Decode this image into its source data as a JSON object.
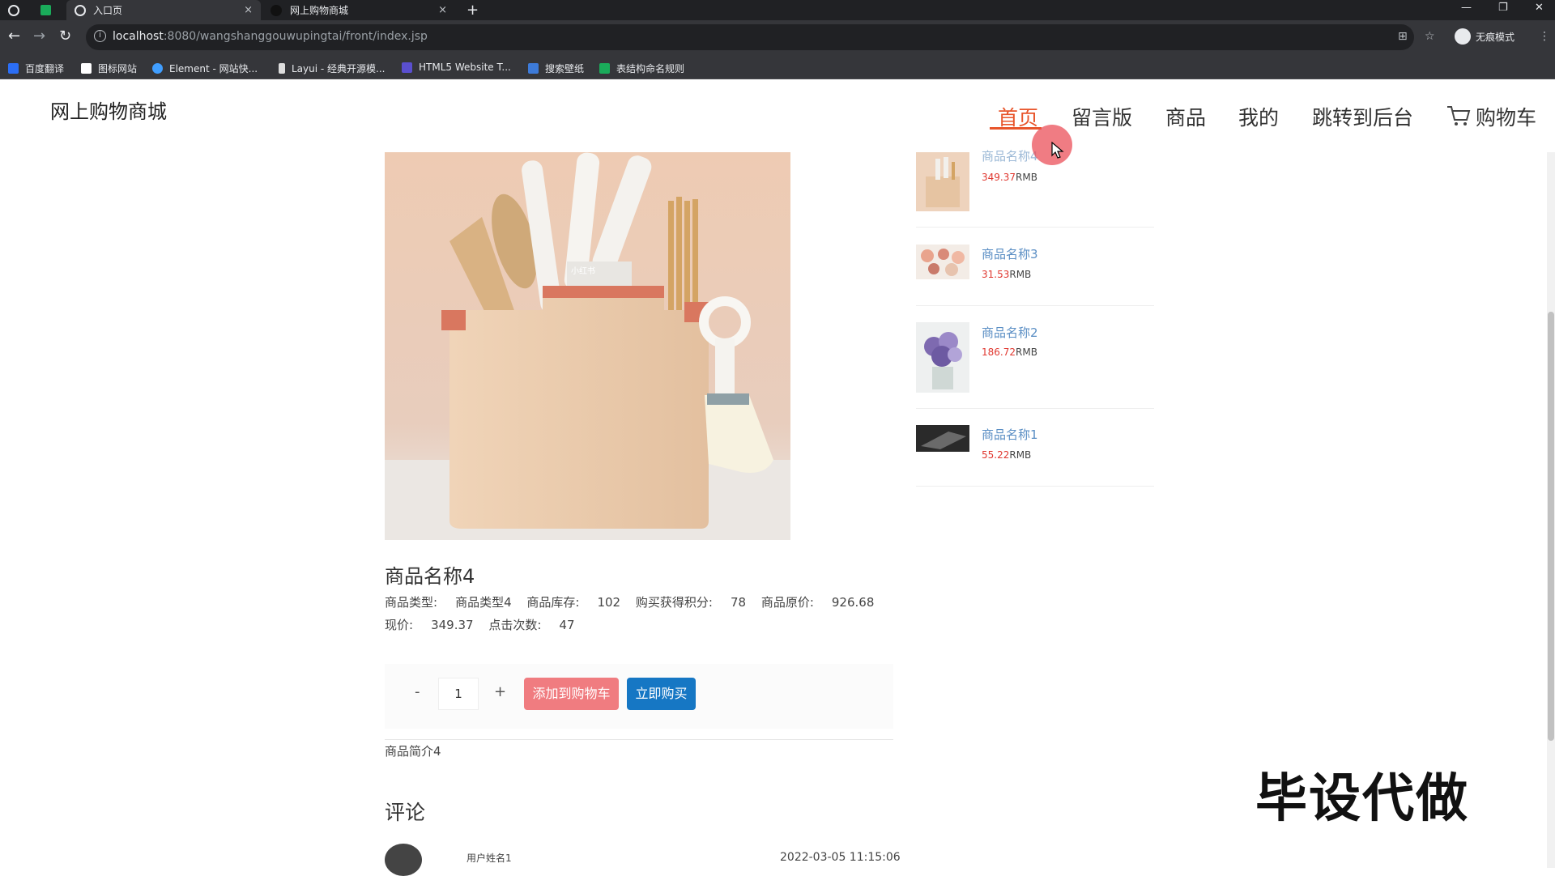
{
  "browser": {
    "tabs": [
      {
        "title": "入口页",
        "close": "×"
      },
      {
        "title": "网上购物商城",
        "close": "×"
      }
    ],
    "new_tab": "+",
    "url_host": "localhost",
    "url_path": ":8080/wangshanggouwupingtai/front/index.jsp",
    "incognito_label": "无痕模式",
    "bookmarks": [
      {
        "label": "百度翻译",
        "color": "#2b6ef5"
      },
      {
        "label": "图标网站",
        "color": "#ffffff"
      },
      {
        "label": "Element - 网站快...",
        "color": "#409eff"
      },
      {
        "label": "Layui - 经典开源模...",
        "color": "#dddddd"
      },
      {
        "label": "HTML5 Website T...",
        "color": "#5a4fcf"
      },
      {
        "label": "搜索壁纸",
        "color": "#3d7bd9"
      },
      {
        "label": "表结构命名规则",
        "color": "#1aab5a"
      }
    ]
  },
  "site": {
    "logo": "网上购物商城",
    "menu": [
      "首页",
      "留言版",
      "商品",
      "我的",
      "跳转到后台",
      "购物车"
    ]
  },
  "product": {
    "name": "商品名称4",
    "type_label": "商品类型:",
    "type_value": "商品类型4",
    "stock_label": "商品库存:",
    "stock_value": "102",
    "points_label": "购买获得积分:",
    "points_value": "78",
    "orig_price_label": "商品原价:",
    "orig_price_value": "926.68",
    "price_label": "现价:",
    "price_value": "349.37",
    "clicks_label": "点击次数:",
    "clicks_value": "47",
    "qty_minus": "-",
    "qty_value": "1",
    "qty_plus": "+",
    "add_cart": "添加到购物车",
    "buy_now": "立即购买",
    "intro": "商品简介4",
    "image_caption": "小红书"
  },
  "comments": {
    "title": "评论",
    "items": [
      {
        "user": "用户姓名1",
        "time": "2022-03-05 11:15:06"
      }
    ]
  },
  "recommend": [
    {
      "name": "商品名称4",
      "price": "349.37",
      "unit": "RMB"
    },
    {
      "name": "商品名称3",
      "price": "31.53",
      "unit": "RMB"
    },
    {
      "name": "商品名称2",
      "price": "186.72",
      "unit": "RMB"
    },
    {
      "name": "商品名称1",
      "price": "55.22",
      "unit": "RMB"
    }
  ],
  "watermark": "毕设代做",
  "colors": {
    "accent": "#e8552b",
    "add_cart": "#f07c80",
    "buy_now": "#1677c4",
    "price": "#e0372f",
    "link": "#5a8ec4"
  }
}
